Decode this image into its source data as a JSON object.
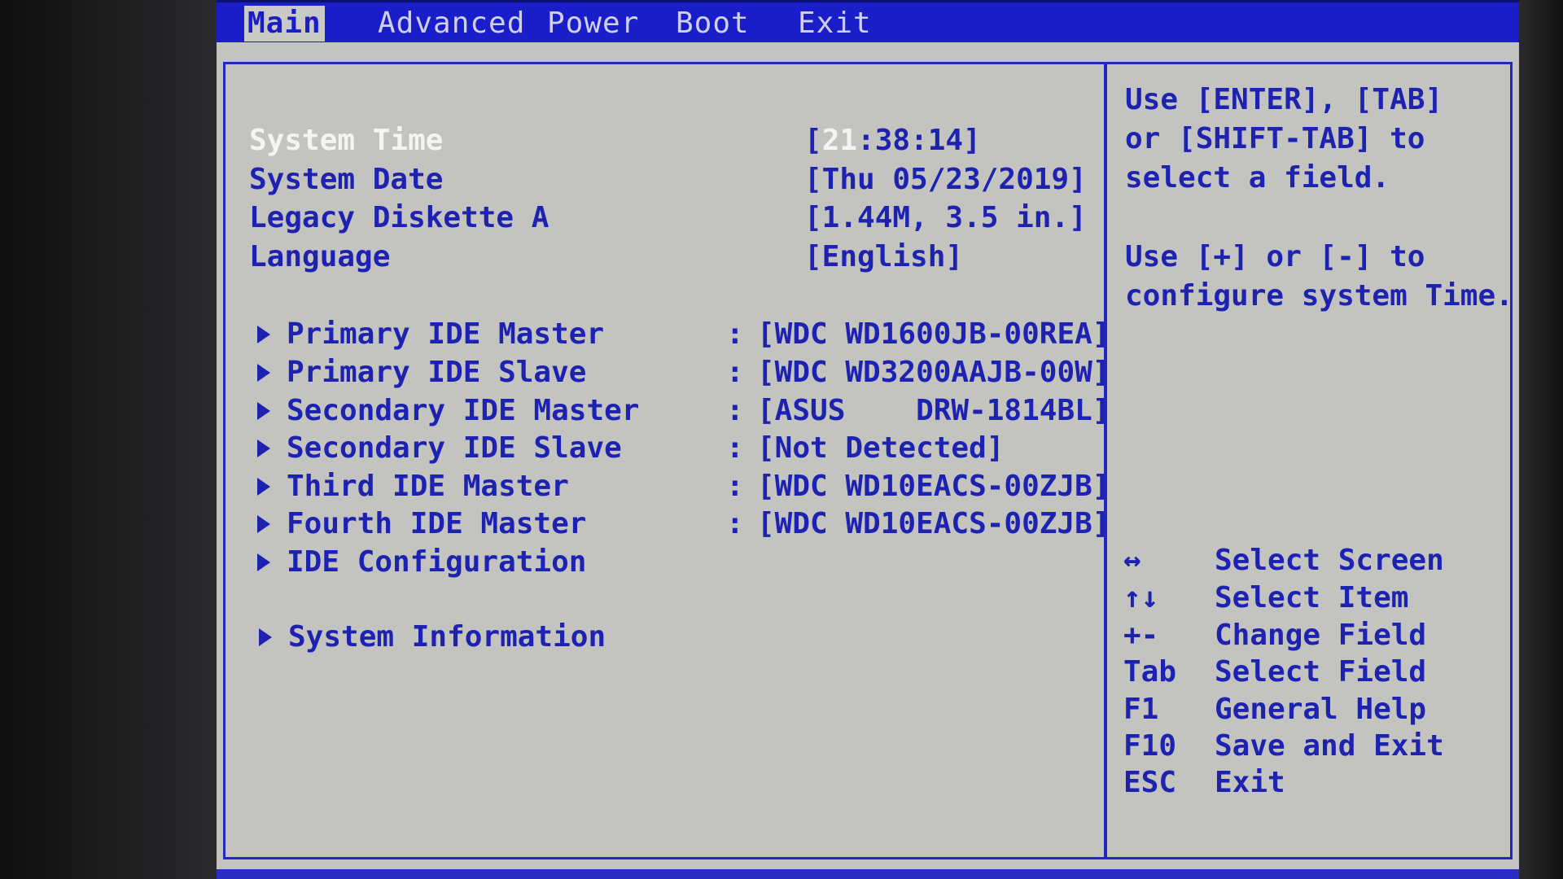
{
  "menu": {
    "tabs": [
      {
        "label": "Main",
        "active": true
      },
      {
        "label": "Advanced"
      },
      {
        "label": "Power"
      },
      {
        "label": "Boot"
      },
      {
        "label": "Exit"
      }
    ]
  },
  "main": {
    "settings": [
      {
        "label": "System Time",
        "value_pre": "[",
        "value_hl": "21",
        "value_post": ":38:14]"
      },
      {
        "label": "System Date",
        "value": "[Thu 05/23/2019]"
      },
      {
        "label": "Legacy Diskette A",
        "value": "[1.44M, 3.5 in.]"
      },
      {
        "label": "Language",
        "value": "[English]"
      }
    ],
    "submenus": [
      {
        "label": "Primary IDE Master",
        "value": "[WDC WD1600JB-00REA]"
      },
      {
        "label": "Primary IDE Slave",
        "value": "[WDC WD3200AAJB-00W]"
      },
      {
        "label": "Secondary IDE Master",
        "value": "[ASUS    DRW-1814BL]"
      },
      {
        "label": "Secondary IDE Slave",
        "value": "[Not Detected]"
      },
      {
        "label": "Third IDE Master",
        "value": "[WDC WD10EACS-00ZJB]"
      },
      {
        "label": "Fourth IDE Master",
        "value": "[WDC WD10EACS-00ZJB]"
      },
      {
        "label": "IDE Configuration"
      },
      {
        "label": "System Information"
      }
    ],
    "separator": ":"
  },
  "help": {
    "lines": [
      "Use [ENTER], [TAB]",
      "or [SHIFT-TAB] to",
      "select a field.",
      "Use [+] or [-] to",
      "configure system Time."
    ],
    "keys": [
      {
        "key": "↔",
        "desc": "Select Screen"
      },
      {
        "key": "↑↓",
        "desc": "Select Item"
      },
      {
        "key": "+-",
        "desc": "Change Field"
      },
      {
        "key": "Tab",
        "desc": "Select Field"
      },
      {
        "key": "F1",
        "desc": "General Help"
      },
      {
        "key": "F10",
        "desc": "Save and Exit"
      },
      {
        "key": "ESC",
        "desc": "Exit"
      }
    ]
  },
  "colors": {
    "bios_blue": "#1d22b0",
    "bios_gray": "#c3c3c0",
    "highlight": "#f4f4f4"
  }
}
